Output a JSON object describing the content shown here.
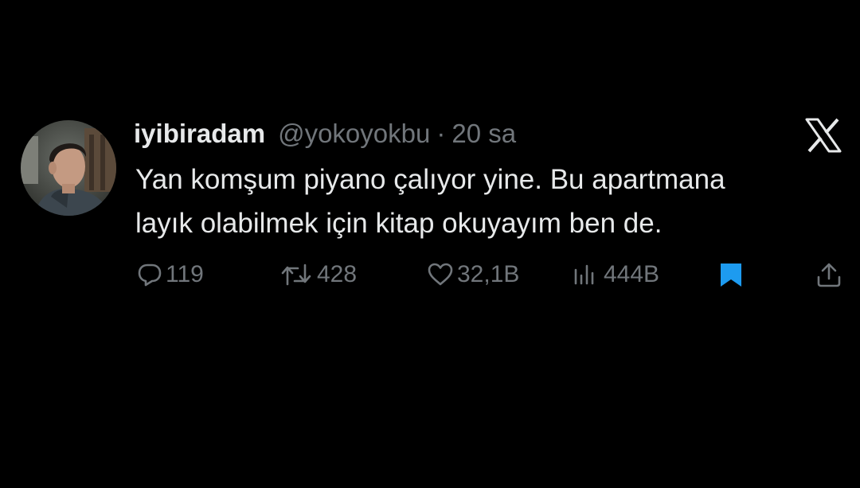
{
  "user": {
    "display_name": "iyibiradam",
    "handle": "@yokoyokbu",
    "separator": "·",
    "timestamp": "20 sa"
  },
  "tweet": {
    "lines": [
      "Yan komşum piyano çalıyor yine. Bu apartmana",
      "layık olabilmek için kitap okuyayım ben de."
    ]
  },
  "actions": {
    "reply_count": "119",
    "retweet_count": "428",
    "like_count": "32,1B",
    "view_count": "444B"
  },
  "icons": {
    "reply": "reply-bubble-icon",
    "retweet": "retweet-icon",
    "like": "heart-icon",
    "views": "views-chart-icon",
    "bookmark": "bookmark-icon",
    "share": "share-icon",
    "brand": "x-logo-icon"
  },
  "colors": {
    "background": "#000000",
    "text_primary": "#e7e9ea",
    "text_secondary": "#71767b",
    "bookmark_active": "#1d9bf0"
  }
}
